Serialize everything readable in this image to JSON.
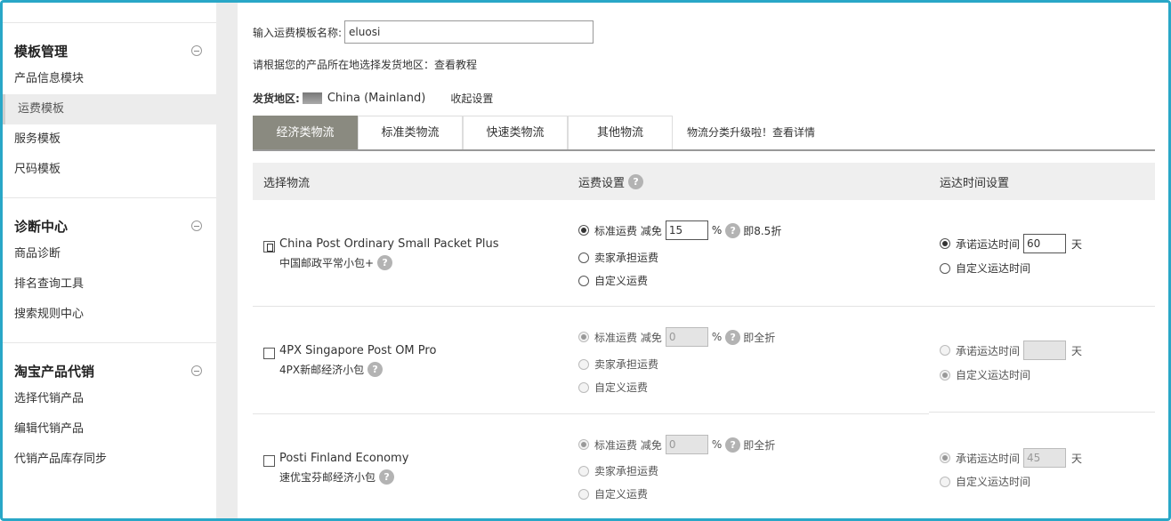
{
  "sidebar": {
    "groups": [
      {
        "title": "模板管理",
        "items": [
          "产品信息模块",
          "运费模板",
          "服务模板",
          "尺码模板"
        ]
      },
      {
        "title": "诊断中心",
        "items": [
          "商品诊断",
          "排名查询工具",
          "搜索规则中心"
        ]
      },
      {
        "title": "淘宝产品代销",
        "items": [
          "选择代销产品",
          "编辑代销产品",
          "代销产品库存同步"
        ]
      }
    ]
  },
  "form": {
    "name_label": "输入运费模板名称:",
    "name_value": "eluosi",
    "tip": "请根据您的产品所在地选择发货地区：查看教程",
    "origin_label": "发货地区:",
    "origin_value": "China (Mainland)",
    "collapse_label": "收起设置"
  },
  "tabs": [
    "经济类物流",
    "标准类物流",
    "快速类物流",
    "其他物流"
  ],
  "tab_note": "物流分类升级啦！查看详情",
  "table_header": {
    "col1": "选择物流",
    "col2": "运费设置",
    "col3": "运达时间设置"
  },
  "labels": {
    "standard": "标准运费 减免",
    "percent": "%",
    "seller": "卖家承担运费",
    "custom": "自定义运费",
    "promise": "承诺运达时间",
    "custom_time": "自定义运达时间",
    "days": "天",
    "help": "?"
  },
  "rows": [
    {
      "name": "China Post Ordinary Small Packet Plus",
      "cn": "中国邮政平常小包+",
      "discount": "15",
      "discount_text": "即8.5折",
      "days": "60"
    },
    {
      "name": "4PX Singapore Post OM Pro",
      "cn": "4PX新邮经济小包",
      "discount": "0",
      "discount_text": "即全折",
      "days": ""
    },
    {
      "name": "Posti Finland Economy",
      "cn": "速优宝芬邮经济小包",
      "discount": "0",
      "discount_text": "即全折",
      "days": "45"
    }
  ]
}
